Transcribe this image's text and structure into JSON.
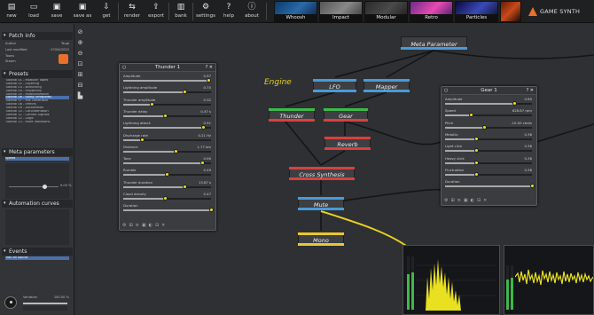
{
  "toolbar": {
    "buttons": [
      {
        "label": "new",
        "icon": "▤"
      },
      {
        "label": "load",
        "icon": "▭"
      },
      {
        "label": "save",
        "icon": "▣"
      },
      {
        "label": "save as",
        "icon": "▣"
      },
      {
        "label": "get",
        "icon": "⇩"
      },
      {
        "label": "render",
        "icon": "⇆"
      },
      {
        "label": "export",
        "icon": "⇪"
      },
      {
        "label": "bank",
        "icon": "▥"
      },
      {
        "label": "settings",
        "icon": "⚙"
      },
      {
        "label": "help",
        "icon": "?"
      },
      {
        "label": "about",
        "icon": "ⓘ"
      }
    ],
    "presets": [
      "Whoosh",
      "Impact",
      "Modular",
      "Retro",
      "Particles"
    ],
    "logo": "GAME SYNTH"
  },
  "left_panel": {
    "patch_info": {
      "title": "Patch info",
      "rows": [
        {
          "k": "Author",
          "v": "Tsugi"
        },
        {
          "k": "Last modified",
          "v": "07/04/2022"
        },
        {
          "k": "Toons",
          "v": ""
        },
        {
          "k": "Steam",
          "v": ""
        }
      ]
    },
    "presets": {
      "title": "Presets",
      "items": [
        "Tutorial 01 - Modular Tapes",
        "Tutorial 02 - Layering",
        "Tutorial 03 - Branching",
        "Tutorial 04 - Polyphony",
        "Tutorial 05 - Modularization",
        "Tutorial 06 - Using Templates",
        "Tutorial 07 - Mix Generator",
        "Tutorial 08 - Effects",
        "Tutorial 09 - Automation",
        "Tutorial 10 - Concatenation",
        "Tutorial 11 - Control Signals",
        "Tutorial 12 - Logic",
        "Tutorial 13 - More Variations"
      ],
      "selected": 5
    },
    "meta": {
      "title": "Meta parameters",
      "selected": "Speed"
    },
    "automation": {
      "title": "Automation curves"
    },
    "events": {
      "title": "Events",
      "selected": "Trail on sound"
    },
    "variation": {
      "label": "Variation",
      "value": "100.00 %"
    },
    "slider_value": "0.00 %"
  },
  "thunder": {
    "title": "Thunder 1",
    "params": [
      {
        "name": "Amplitude",
        "value": "0.97",
        "pct": 0.97
      },
      {
        "name": "Lightning amplitude",
        "value": "0.70",
        "pct": 0.7
      },
      {
        "name": "Thunder amplitude",
        "value": "0.32",
        "pct": 0.32
      },
      {
        "name": "Thunder delay",
        "value": "0.47 s",
        "pct": 0.47
      },
      {
        "name": "Lightning attack",
        "value": "0.91",
        "pct": 0.91
      },
      {
        "name": "Discharge rate",
        "value": "0.21 Hz",
        "pct": 0.21
      },
      {
        "name": "Distance",
        "value": "1.77 km",
        "pct": 0.6
      },
      {
        "name": "Tone",
        "value": "0.90",
        "pct": 0.9
      },
      {
        "name": "Rumble",
        "value": "0.49",
        "pct": 0.49
      },
      {
        "name": "Thunder duration",
        "value": "13.87 s",
        "pct": 0.7
      },
      {
        "name": "Cloud density",
        "value": "0.47",
        "pct": 0.47
      },
      {
        "name": "Duration",
        "value": "",
        "pct": 1.0
      }
    ]
  },
  "gear": {
    "title": "Gear 1",
    "params": [
      {
        "name": "Amplitude",
        "value": "0.80",
        "pct": 0.8
      },
      {
        "name": "Speed",
        "value": "628.87 rpm",
        "pct": 0.3
      },
      {
        "name": "Pitch",
        "value": "-10.00 cents",
        "pct": 0.45
      },
      {
        "name": "Metallic",
        "value": "0.36",
        "pct": 0.36
      },
      {
        "name": "Light click",
        "value": "0.36",
        "pct": 0.36
      },
      {
        "name": "Heavy click",
        "value": "0.36",
        "pct": 0.36
      },
      {
        "name": "Fluctuation",
        "value": "0.36",
        "pct": 0.36
      },
      {
        "name": "Duration",
        "value": "",
        "pct": 1.0
      }
    ]
  },
  "graph": {
    "engine_label": "Engine",
    "nodes": [
      "Meta Parameter",
      "LFO",
      "Mapper",
      "Thunder",
      "Gear",
      "Reverb",
      "Cross Synthesis",
      "Mute",
      "Mono"
    ]
  },
  "colors": {
    "accent": "#e8e020",
    "blue": "#4a9ad8",
    "red": "#d84040",
    "green": "#3fb84a",
    "yellow": "#e8c830",
    "waveform": "#e8e020"
  }
}
